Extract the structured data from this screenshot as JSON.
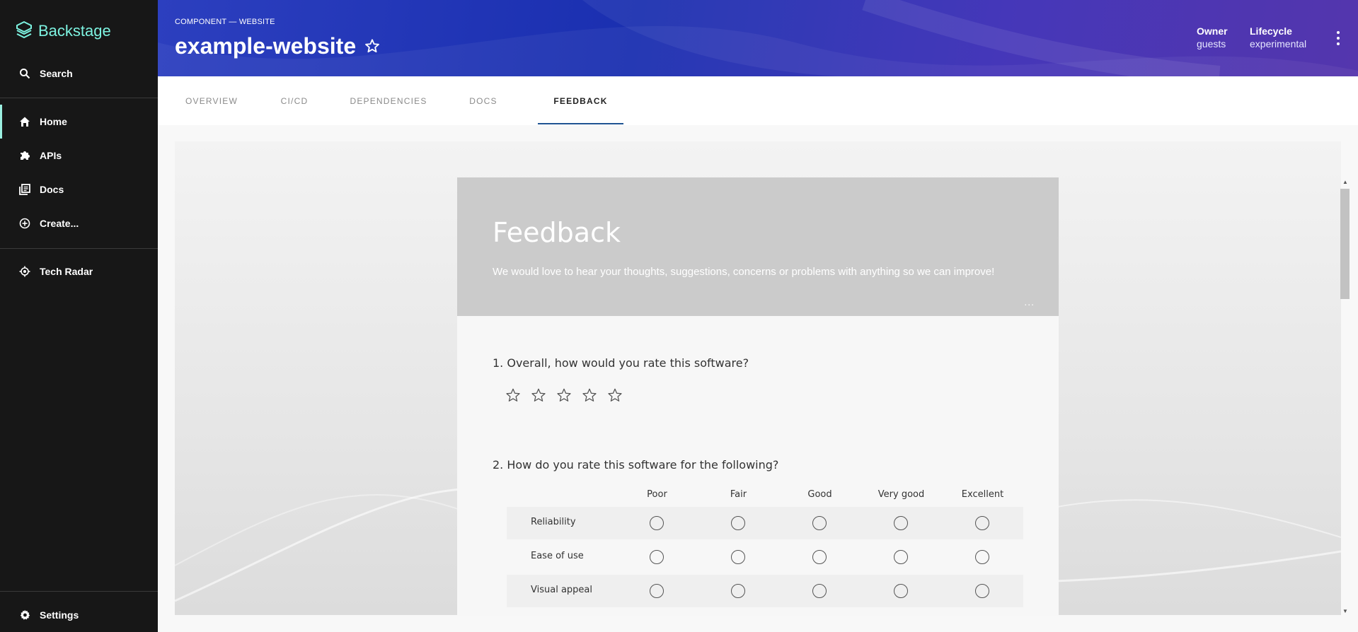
{
  "app": {
    "name": "Backstage"
  },
  "sidebar": {
    "items": [
      {
        "label": "Search",
        "icon": "search-icon"
      },
      {
        "label": "Home",
        "icon": "home-icon",
        "active": true
      },
      {
        "label": "APIs",
        "icon": "puzzle-icon"
      },
      {
        "label": "Docs",
        "icon": "library-icon"
      },
      {
        "label": "Create...",
        "icon": "add-circle-icon"
      },
      {
        "label": "Tech Radar",
        "icon": "radar-icon"
      },
      {
        "label": "Settings",
        "icon": "gear-icon"
      }
    ],
    "accent": "#7df3e1"
  },
  "header": {
    "kind": "COMPONENT — WEBSITE",
    "title": "example-website",
    "owner_label": "Owner",
    "owner_value": "guests",
    "lifecycle_label": "Lifecycle",
    "lifecycle_value": "experimental"
  },
  "tabs": [
    {
      "label": "OVERVIEW"
    },
    {
      "label": "CI/CD"
    },
    {
      "label": "DEPENDENCIES"
    },
    {
      "label": "DOCS"
    },
    {
      "label": "FEEDBACK",
      "active": true
    }
  ],
  "survey": {
    "title": "Feedback",
    "description": "We would love to hear your thoughts, suggestions, concerns or problems with anything so we can improve!",
    "more": "...",
    "q1": {
      "number": "1.",
      "text": "Overall, how would you rate this software?",
      "rating_max": 5,
      "rating_value": 0
    },
    "q2": {
      "number": "2.",
      "text": "How do you rate this software for the following?",
      "columns": [
        "Poor",
        "Fair",
        "Good",
        "Very good",
        "Excellent"
      ],
      "rows": [
        "Reliability",
        "Ease of use",
        "Visual appeal"
      ]
    }
  }
}
